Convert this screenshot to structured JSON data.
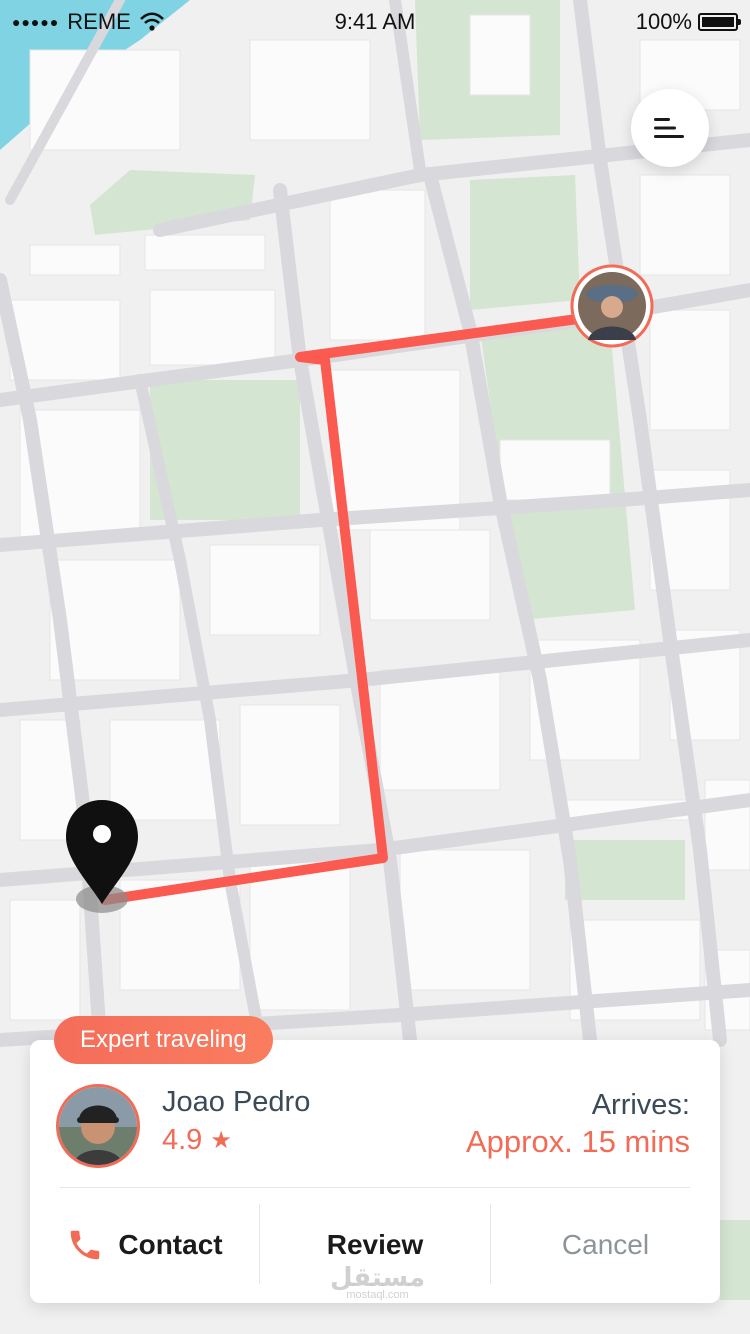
{
  "status_bar": {
    "signal_dots": "●●●●●",
    "carrier": "REME",
    "time": "9:41 AM",
    "battery": "100%"
  },
  "map": {
    "menu_icon": "menu-lines-icon",
    "destination_icon": "location-pin-icon",
    "route_color": "#fa5a50",
    "park_color": "#cfe4cc",
    "water_color": "#7fd3e3"
  },
  "trip_card": {
    "badge": "Expert traveling",
    "driver_name": "Joao Pedro",
    "rating_value": "4.9",
    "rating_star": "★",
    "arrives_label": "Arrives:",
    "eta": "Approx. 15 mins",
    "actions": {
      "contact": "Contact",
      "review": "Review",
      "cancel": "Cancel"
    },
    "accent_color": "#f26b56"
  },
  "watermark": {
    "main": "مستقل",
    "sub": "mostaql.com"
  }
}
